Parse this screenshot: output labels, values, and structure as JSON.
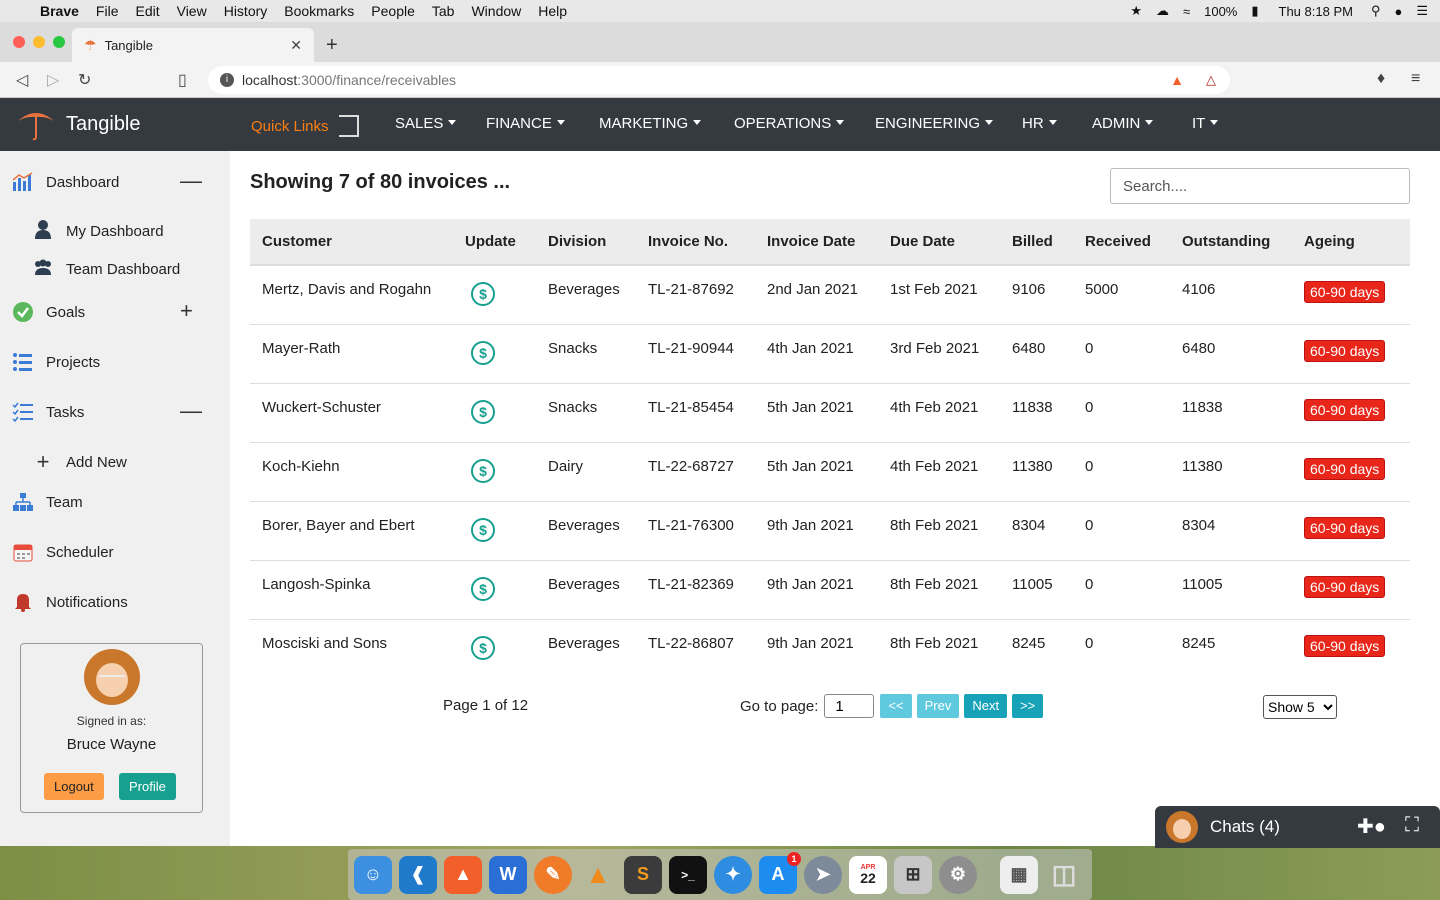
{
  "menubar": {
    "app": "Brave",
    "items": [
      "File",
      "Edit",
      "View",
      "History",
      "Bookmarks",
      "People",
      "Tab",
      "Window",
      "Help"
    ],
    "battery": "100%",
    "clock": "Thu 8:18 PM"
  },
  "browser": {
    "tab_title": "Tangible",
    "url_host": "localhost",
    "url_rest": ":3000/finance/receivables"
  },
  "app": {
    "brand": "Tangible",
    "quick_links": "Quick Links",
    "menus": [
      "SALES",
      "FINANCE",
      "MARKETING",
      "OPERATIONS",
      "ENGINEERING",
      "HR",
      "ADMIN",
      "IT"
    ]
  },
  "sidebar": {
    "dashboard": "Dashboard",
    "my_dashboard": "My Dashboard",
    "team_dashboard": "Team Dashboard",
    "goals": "Goals",
    "projects": "Projects",
    "tasks": "Tasks",
    "add_new": "Add New",
    "team": "Team",
    "scheduler": "Scheduler",
    "notifications": "Notifications",
    "signed_in_label": "Signed in as:",
    "user_name": "Bruce Wayne",
    "logout": "Logout",
    "profile": "Profile"
  },
  "main": {
    "heading": "Showing 7 of 80 invoices ...",
    "search_placeholder": "Search....",
    "columns": [
      "Customer",
      "Update",
      "Division",
      "Invoice No.",
      "Invoice Date",
      "Due Date",
      "Billed",
      "Received",
      "Outstanding",
      "Ageing"
    ],
    "rows": [
      {
        "customer": "Mertz, Davis and Rogahn",
        "division": "Beverages",
        "invoice": "TL-21-87692",
        "date": "2nd Jan 2021",
        "due": "1st Feb 2021",
        "billed": "9106",
        "received": "5000",
        "outstanding": "4106",
        "ageing": "60-90 days"
      },
      {
        "customer": "Mayer-Rath",
        "division": "Snacks",
        "invoice": "TL-21-90944",
        "date": "4th Jan 2021",
        "due": "3rd Feb 2021",
        "billed": "6480",
        "received": "0",
        "outstanding": "6480",
        "ageing": "60-90 days"
      },
      {
        "customer": "Wuckert-Schuster",
        "division": "Snacks",
        "invoice": "TL-21-85454",
        "date": "5th Jan 2021",
        "due": "4th Feb 2021",
        "billed": "11838",
        "received": "0",
        "outstanding": "11838",
        "ageing": "60-90 days"
      },
      {
        "customer": "Koch-Kiehn",
        "division": "Dairy",
        "invoice": "TL-22-68727",
        "date": "5th Jan 2021",
        "due": "4th Feb 2021",
        "billed": "11380",
        "received": "0",
        "outstanding": "11380",
        "ageing": "60-90 days"
      },
      {
        "customer": "Borer, Bayer and Ebert",
        "division": "Beverages",
        "invoice": "TL-21-76300",
        "date": "9th Jan 2021",
        "due": "8th Feb 2021",
        "billed": "8304",
        "received": "0",
        "outstanding": "8304",
        "ageing": "60-90 days"
      },
      {
        "customer": "Langosh-Spinka",
        "division": "Beverages",
        "invoice": "TL-21-82369",
        "date": "9th Jan 2021",
        "due": "8th Feb 2021",
        "billed": "11005",
        "received": "0",
        "outstanding": "11005",
        "ageing": "60-90 days"
      },
      {
        "customer": "Mosciski and Sons",
        "division": "Beverages",
        "invoice": "TL-22-86807",
        "date": "9th Jan 2021",
        "due": "8th Feb 2021",
        "billed": "8245",
        "received": "0",
        "outstanding": "8245",
        "ageing": "60-90 days"
      }
    ],
    "page_text": "Page 1 of 12",
    "goto_label": "Go to page:",
    "goto_value": "1",
    "first": "<<",
    "prev": "Prev",
    "next": "Next",
    "last": ">>",
    "show_selected": "Show 5"
  },
  "chat": {
    "label": "Chats (4)"
  },
  "dock": {
    "calendar_month": "APR",
    "calendar_day": "22",
    "appstore_badge": "1"
  },
  "colors": {
    "nav_bg": "#343a40",
    "accent_orange": "#fd7e14",
    "teal": "#17a08f",
    "ageing_red": "#e8261a",
    "pager_blue": "#17a2b8"
  }
}
